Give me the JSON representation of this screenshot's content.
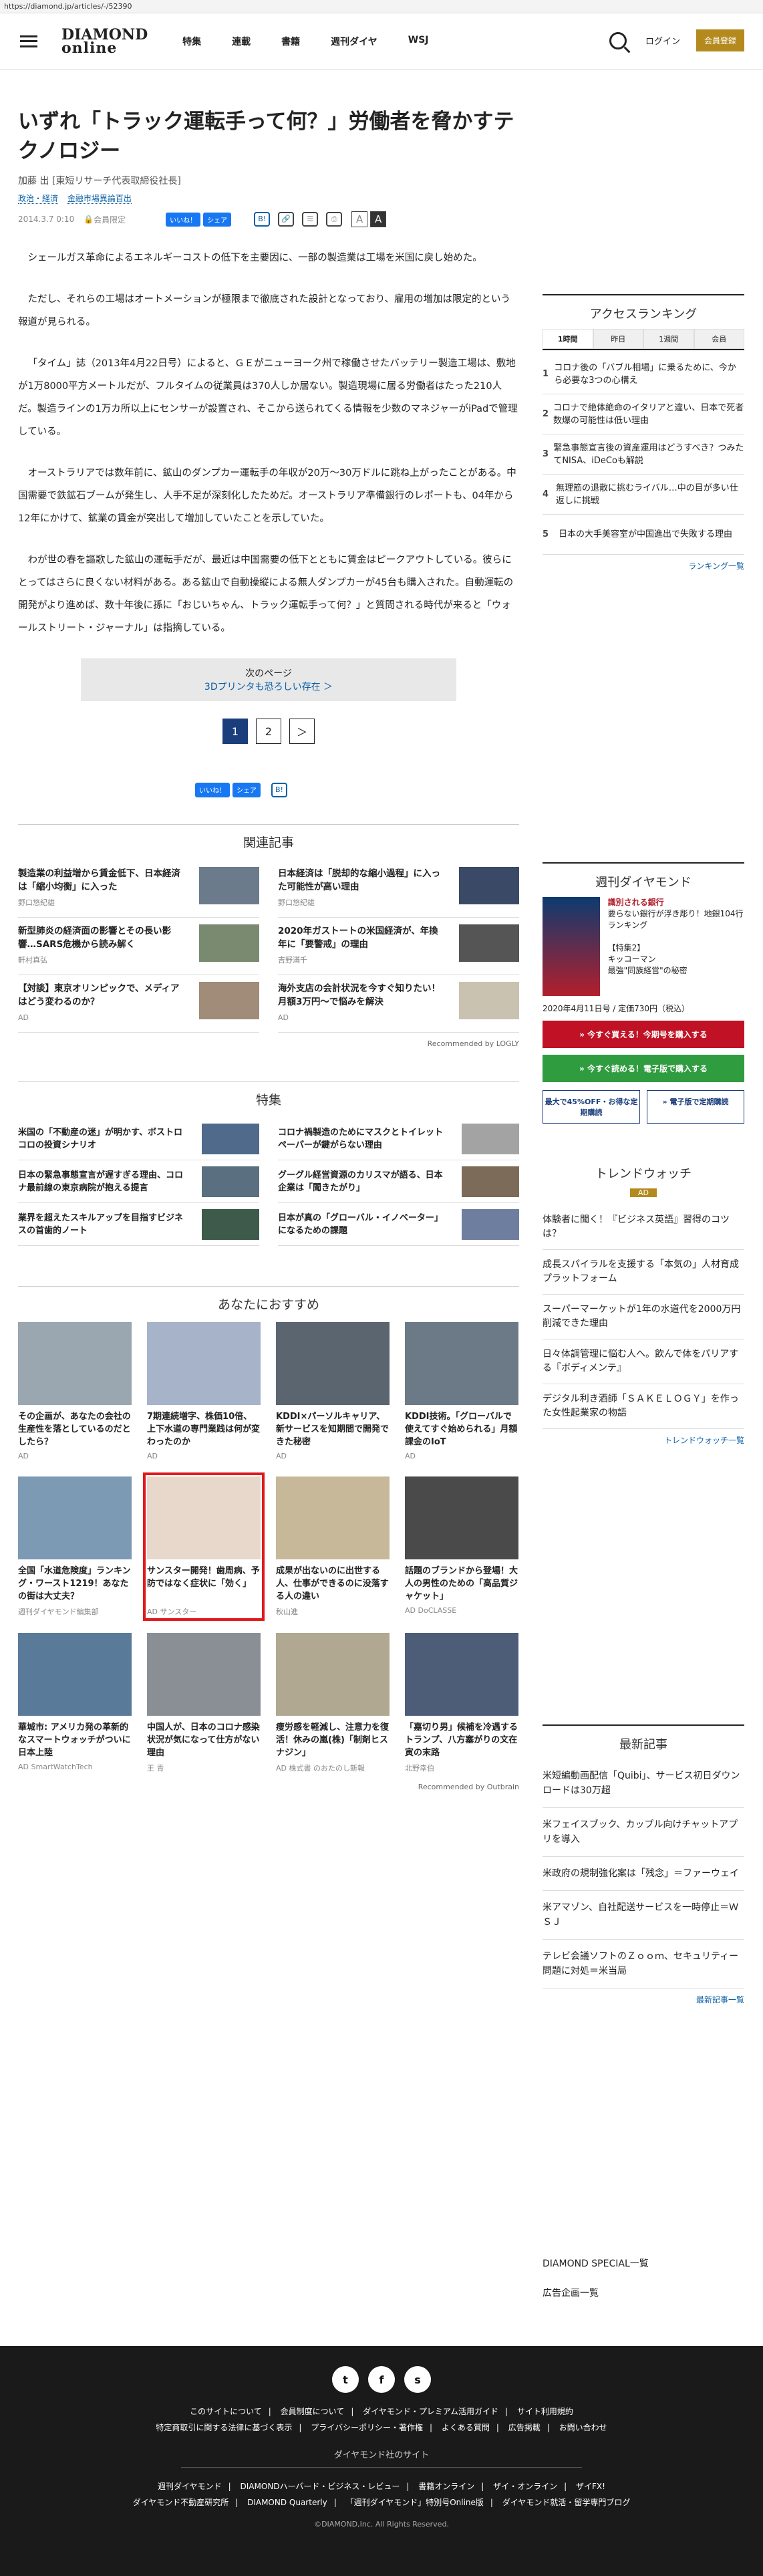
{
  "url": "https://diamond.jp/articles/-/52390",
  "header": {
    "logo1": "DIAMOND",
    "logo2": "online",
    "nav": [
      "特集",
      "連載",
      "書籍",
      "週刊ダイヤ",
      "WSJ"
    ],
    "login": "ログイン",
    "register": "会員登録"
  },
  "article": {
    "title": "いずれ「トラック運転手って何？」労働者を脅かすテクノロジー",
    "author": "加藤 出 [東短リサーチ代表取締役社長]",
    "tags": [
      "政治・経済",
      "金融市場異論百出"
    ],
    "date": "2014.3.7 0:10",
    "member": "会員限定",
    "fb": "いいね！",
    "share": "シェア",
    "b": "B!",
    "paragraphs": [
      "シェールガス革命によるエネルギーコストの低下を主要因に、一部の製造業は工場を米国に戻し始めた。",
      "ただし、それらの工場はオートメーションが極限まで徹底された設計となっており、雇用の増加は限定的という報道が見られる。",
      "「タイム」誌（2013年4月22日号）によると、ＧＥがニューヨーク州で稼働させたバッテリー製造工場は、敷地が1万8000平方メートルだが、フルタイムの従業員は370人しか居ない。製造現場に居る労働者はたった210人だ。製造ラインの1万カ所以上にセンサーが設置され、そこから送られてくる情報を少数のマネジャーがiPadで管理している。",
      "オーストラリアでは数年前に、鉱山のダンプカー運転手の年収が20万〜30万ドルに跳ね上がったことがある。中国需要で鉄鉱石ブームが発生し、人手不足が深刻化したためだ。オーストラリア準備銀行のレポートも、04年から12年にかけて、鉱業の賃金が突出して増加していたことを示していた。",
      "わが世の春を謳歌した鉱山の運転手だが、最近は中国需要の低下とともに賃金はピークアウトしている。彼らにとってはさらに良くない材料がある。ある鉱山で自動操縦による無人ダンプカーが45台も購入された。自動運転の開発がより進めば、数十年後に孫に「おじいちゃん、トラック運転手って何？」と質問される時代が来ると「ウォールストリート・ジャーナル」は指摘している。"
    ],
    "next_label": "次のページ",
    "next_title": "3Dプリンタも恐ろしい存在 ＞",
    "pages": [
      "1",
      "2",
      "＞"
    ]
  },
  "related": {
    "heading": "関連記事",
    "items": [
      {
        "t": "製造業の利益増から賃金低下、日本経済は「縮小均衡」に入った",
        "s": "野口悠紀雄"
      },
      {
        "t": "日本経済は「脱却的な縮小過程」に入った可能性が高い理由",
        "s": "野口悠紀雄"
      },
      {
        "t": "新型肺炎の経済面の影響とその長い影響…SARS危機から読み解く",
        "s": "軒村真弘"
      },
      {
        "t": "2020年ガストートの米国経済が、年換年に「要警戒」の理由",
        "s": "吉野滿千"
      },
      {
        "t": "【対談】東京オリンピックで、メディアはどう変わるのか？",
        "s": "AD"
      },
      {
        "t": "海外支店の会計状況を今すぐ知りたい！月額3万円〜で悩みを解決",
        "s": "AD"
      }
    ],
    "recommended": "Recommended by LOGLY"
  },
  "special": {
    "heading": "特集",
    "items": [
      "米国の「不動産の迷」が明かす、ボストロコロの投資シナリオ",
      "コロナ禍製造のためにマスクとトイレットペーパーが鍵がらない理由",
      "日本の緊急事態宣言が遅すぎる理由、コロナ最前線の東京病院が抱える提言",
      "グーグル経営資源のカリスマが語る、日本企業は「聞きたがり」",
      "業界を超えたスキルアップを目指すビジネスの首歯的ノート",
      "日本が真の「グローバル・イノベーター」になるための課題"
    ]
  },
  "recommend": {
    "heading": "あなたにおすすめ",
    "items": [
      {
        "t": "その企画が、あなたの会社の生産性を落としているのだとしたら？",
        "s": "AD"
      },
      {
        "t": "7期連続増字、株価10倍、上下水道の専門業践は何が変わったのか",
        "s": "AD"
      },
      {
        "t": "KDDI×パーソルキャリア、新サービスを知期間で開発できた秘密",
        "s": "AD"
      },
      {
        "t": "KDDI技術。「グローバルで使えてすぐ始められる」月額課金のIoT",
        "s": "AD"
      },
      {
        "t": "全国「水道危険度」ランキング・ワースト1219！あなたの街は大丈夫？",
        "s": "週刊ダイヤモンド編集部"
      },
      {
        "t": "サンスター開発！歯周病、予防ではなく症状に「効く」",
        "s": "AD サンスター"
      },
      {
        "t": "成果が出ないのに出世する人、仕事ができるのに没落する人の違い",
        "s": "秋山進"
      },
      {
        "t": "話題のブランドから登場！大人の男性のための「高品質ジャケット」",
        "s": "AD DoCLASSE"
      },
      {
        "t": "華城市: アメリカ発の革新的なスマートウォッチがついに日本上陸",
        "s": "AD SmartWatchTech"
      },
      {
        "t": "中国人が、日本のコロナ感染状況が気になって仕方がない理由",
        "s": "王 青"
      },
      {
        "t": "痩労感を軽減し、注意力を復活！休みの嵐(株)「制剤ヒスナジン」",
        "s": "AD 株式書 のおたのし新報"
      },
      {
        "t": "「嘉切り男」候補を冷遇するトランプ、八方塞がりの文在寅の末路",
        "s": "北野幸伯"
      }
    ],
    "outbrain": "Recommended by Outbrain"
  },
  "ranking": {
    "heading": "アクセスランキング",
    "tabs": [
      "1時間",
      "昨日",
      "1週間",
      "会員"
    ],
    "items": [
      "コロナ後の「バブル相場」に乗るために、今から必要な3つの心構え",
      "コロナで絶体絶命のイタリアと違い、日本で死者数爆の可能性は低い理由",
      "緊急事態宣言後の資産運用はどうすべき？つみたてNISA、iDeCoも解説",
      "無理筋の退散に挑むライバル…中の目が多い仕返しに挑戦",
      "日本の大手美容室が中国進出で失敗する理由"
    ],
    "more": "ランキング一覧"
  },
  "weekly": {
    "heading": "週刊ダイヤモンド",
    "title1": "識別される銀行",
    "title2": "要らない銀行が浮き彫り！地銀104行ランキング",
    "f2": "【特集2】",
    "f2b": "キッコーマン",
    "f2c": "最強\"同族経営\"の秘密",
    "date": "2020年4月11日号 / 定価730円（税込）",
    "buy": "» 今すぐ買える！今期号を購入する",
    "digital": "» 今すぐ読める！電子版で購入する",
    "b1": "最大で45%OFF・お得な定期購読",
    "b2": "» 電子版で定期購読"
  },
  "trend": {
    "heading": "トレンドウォッチ",
    "ad": "AD",
    "items": [
      "体験者に聞く！『ビジネス英語』習得のコツは？",
      "成長スパイラルを支援する「本気の」人材育成プラットフォーム",
      "スーパーマーケットが1年の水道代を2000万円削減できた理由",
      "日々体調管理に悩む人へ。飲んで体をパリアする『ボディメンテ』",
      "デジタル利き酒師「ＳＡＫＥＬＯＧＹ」を作った女性起業家の物語"
    ],
    "more": "トレンドウォッチ一覧"
  },
  "news": {
    "heading": "最新記事",
    "items": [
      "米短編動画配信「Quibi」、サービス初日ダウンロードは30万超",
      "米フェイスブック、カップル向けチャットアプリを導入",
      "米政府の規制強化案は「残念」＝ファーウェイ",
      "米アマゾン、自社配送サービスを一時停止＝ＷＳＪ",
      "テレビ会議ソフトのＺｏｏｍ、セキュリティー問題に対処＝米当局"
    ],
    "more": "最新記事一覧"
  },
  "side_links": [
    "DIAMOND SPECIAL一覧",
    "広告企画一覧"
  ],
  "footer": {
    "social": [
      "t",
      "f",
      "s"
    ],
    "row1": [
      "このサイトについて",
      "会員制度について",
      "ダイヤモンド・プレミアム活用ガイド",
      "サイト利用規約"
    ],
    "row2": [
      "特定商取引に関する法律に基づく表示",
      "プライバシーポリシー・著作権",
      "よくある質問",
      "広告掲載",
      "お問い合わせ"
    ],
    "brand": "ダイヤモンド社のサイト",
    "row3": [
      "週刊ダイヤモンド",
      "DIAMONDハーバード・ビジネス・レビュー",
      "書籍オンライン",
      "ザイ・オンライン",
      "ザイFX!"
    ],
    "row4": [
      "ダイヤモンド不動産研究所",
      "DIAMOND Quarterly",
      "「週刊ダイヤモンド」特別号Online版",
      "ダイヤモンド就活・留学専門ブログ"
    ],
    "copy": "©DIAMOND,Inc. All Rights Reserved."
  }
}
